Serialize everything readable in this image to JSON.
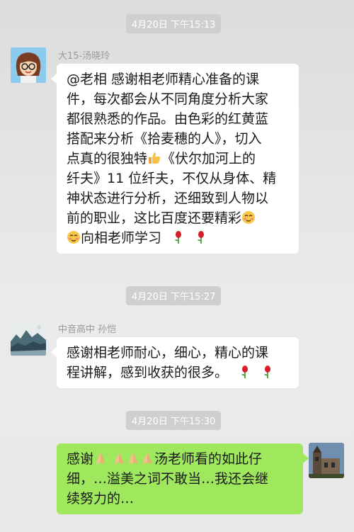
{
  "messages": [
    {
      "timestamp": "4月20日 下午15:13",
      "sender": "大15-汤晓玲",
      "avatar_icon": "cartoon-girl-avatar",
      "lines": [
        "@老相  感谢相老师精心准备的课",
        "件，每次都会从不同角度分析大家",
        "都很熟悉的作品。由色彩的红黄蓝",
        "搭配来分析《拾麦穗的人》，切入",
        "点真的很独特",
        "《伏尔加河上的",
        "纤夫》11 位纤夫，不仅从身体、精",
        "神状态进行分析，还细致到人物以",
        "前的职业，这比百度还要精彩",
        "向相老师学习"
      ]
    },
    {
      "timestamp": "4月20日 下午15:27",
      "sender": "中音高中  孙恺",
      "avatar_icon": "landscape-painting-avatar",
      "lines": [
        "感谢相老师耐心，细心，精心的课",
        "程讲解，感到收获的很多。"
      ]
    },
    {
      "timestamp": "4月20日 下午15:30",
      "avatar_icon": "building-photo-avatar",
      "lines": [
        "感谢",
        "汤老师看的如此仔",
        "细，…溢美之词不敢当…我还会继",
        "续努力的…"
      ]
    }
  ],
  "colors": {
    "background": "#e6e6e6",
    "timestamp_bg": "#cfcfcf",
    "incoming_bubble": "#ffffff",
    "outgoing_bubble": "#9fe85d"
  }
}
